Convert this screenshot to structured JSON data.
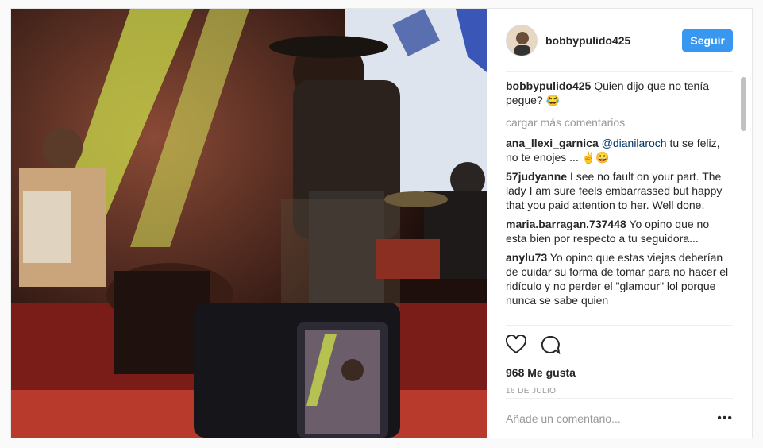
{
  "post": {
    "username": "bobbypulido425",
    "follow_label": "Seguir",
    "caption": {
      "user": "bobbypulido425",
      "text": "Quien dijo que no tenía pegue? 😂"
    },
    "load_more": "cargar más comentarios",
    "comments": [
      {
        "user": "ana_llexi_garnica",
        "mention": "@dianilaroch",
        "text": " tu se feliz, no te enojes ... ✌️😀"
      },
      {
        "user": "57judyanne",
        "mention": "",
        "text": "I see no fault on your part. The lady I am sure feels embarrassed but happy that you paid attention to her. Well done."
      },
      {
        "user": "maria.barragan.737448",
        "mention": "",
        "text": "Yo opino que no esta bien por respecto a tu seguidora..."
      },
      {
        "user": "anylu73",
        "mention": "",
        "text": "Yo opino que estas viejas deberían de cuidar su forma de tomar para no hacer el ridículo y no perder el \"glamour\" lol porque nunca se sabe quien"
      }
    ],
    "likes": "968 Me gusta",
    "date": "16 DE JULIO",
    "add_comment_placeholder": "Añade un comentario...",
    "more_label": "•••",
    "colors": {
      "accent": "#3897f0",
      "text": "#262626",
      "muted": "#999999"
    },
    "icons": {
      "like": "heart-icon",
      "comment": "comment-icon",
      "options": "more-options-icon"
    }
  }
}
